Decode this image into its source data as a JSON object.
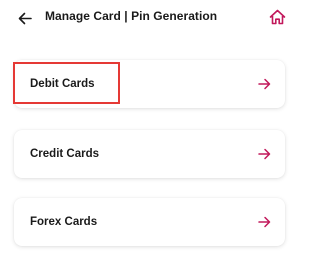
{
  "header": {
    "title": "Manage Card | Pin Generation",
    "back_icon": "arrow-left-icon",
    "home_icon": "home-icon"
  },
  "cards": [
    {
      "label": "Debit Cards",
      "icon": "arrow-right-icon"
    },
    {
      "label": "Credit Cards",
      "icon": "arrow-right-icon"
    },
    {
      "label": "Forex Cards",
      "icon": "arrow-right-icon"
    }
  ],
  "colors": {
    "accent": "#c2185b",
    "highlight": "#e53935",
    "text": "#1a1a1a"
  }
}
